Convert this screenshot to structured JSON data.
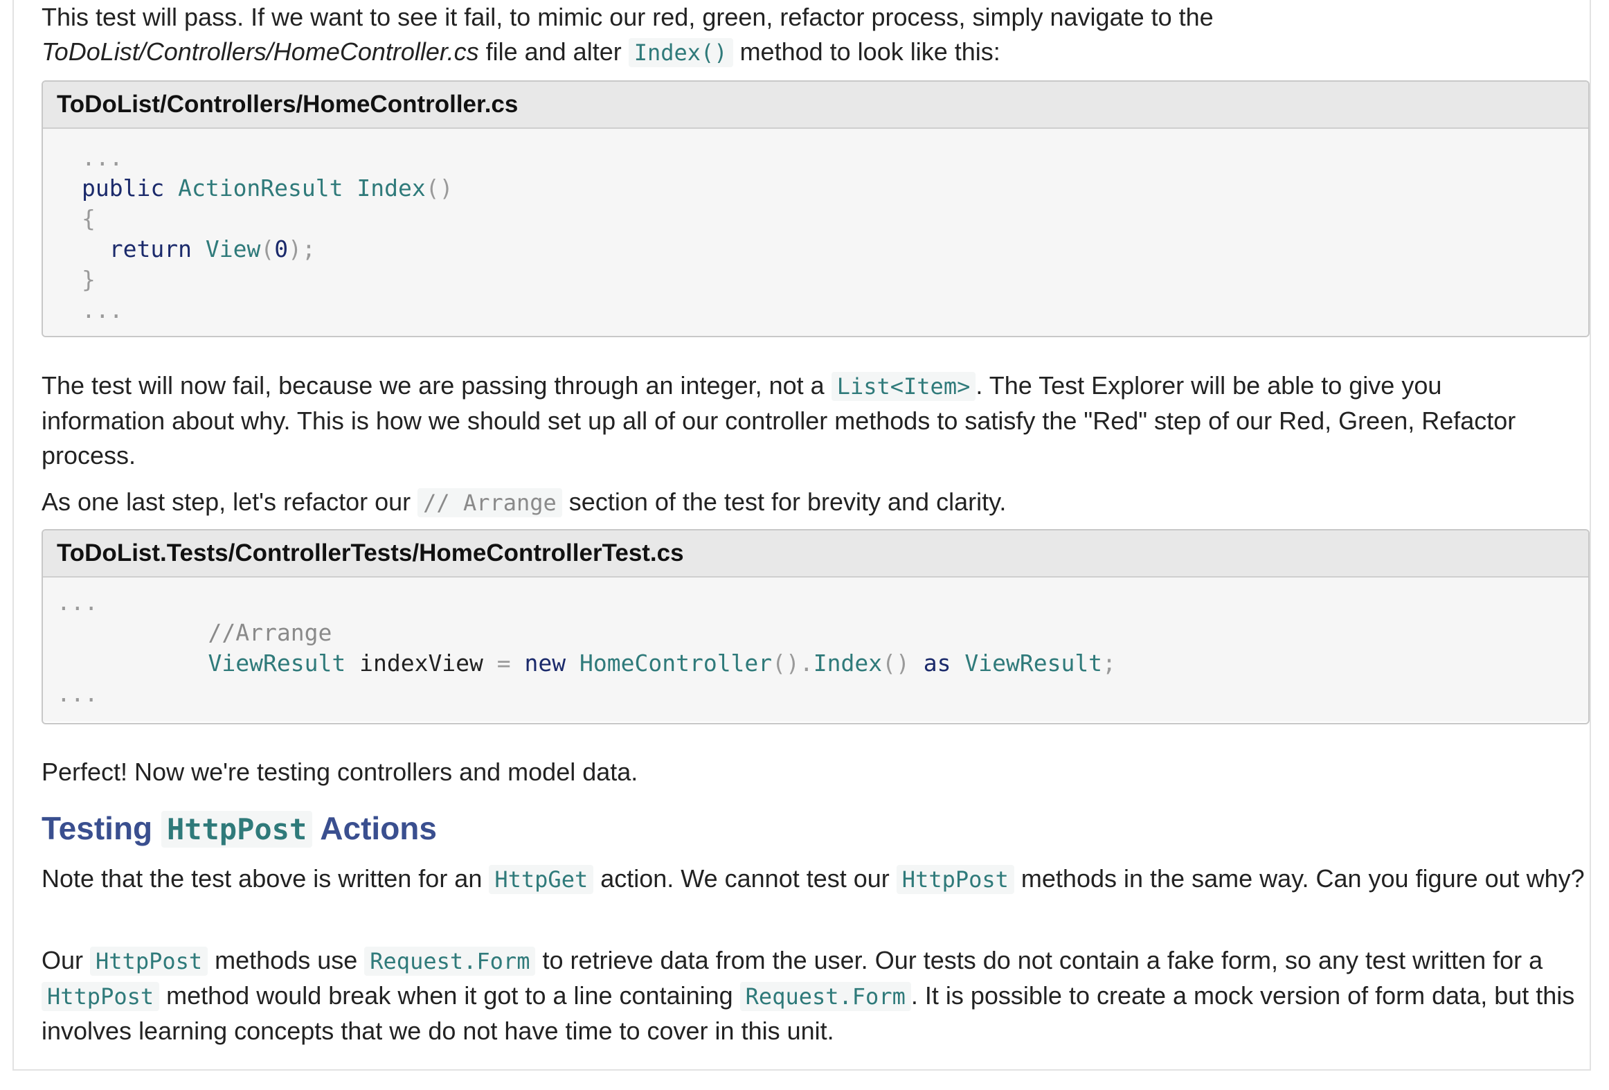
{
  "para1": {
    "t1": "This test will pass. If we want to see it fail, to mimic our red, green, refactor process, simply navigate to the",
    "path": "ToDoList/Controllers/HomeController.cs",
    "t2": " file and alter ",
    "code": "Index()",
    "t3": " method to look like this:"
  },
  "block1": {
    "title": "ToDoList/Controllers/HomeController.cs",
    "ellipsis": "...",
    "kw_public": "public",
    "type_actionresult": "ActionResult",
    "fn_index": "Index",
    "parens": "()",
    "brace_open": "{",
    "kw_return": "return",
    "fn_view": "View",
    "paren_open": "(",
    "arg_zero": "0",
    "paren_close_semi": ");",
    "brace_close": "}"
  },
  "para2": {
    "t1": "The test will now fail, because we are passing through an integer, not a ",
    "code": "List<Item>",
    "t2": ". The Test Explorer will be able to give you information about why. This is how we should set up all of our controller methods to satisfy the \"Red\" step of our Red, Green, Refactor process."
  },
  "para3": {
    "t1": "As one last step, let's refactor our ",
    "code": "// Arrange",
    "t2": " section of the test for brevity and clarity."
  },
  "block2": {
    "title": "ToDoList.Tests/ControllerTests/HomeControllerTest.cs",
    "ellipsis": "...",
    "comment": "//Arrange",
    "type_viewresult": "ViewResult",
    "var_name": " indexView ",
    "eq": "=",
    "kw_new": "new",
    "type_homecontroller": "HomeController",
    "call_parens": "().",
    "fn_index": "Index",
    "parens": "()",
    "kw_as": "as",
    "type_viewresult2": "ViewResult",
    "semi": ";"
  },
  "para4": {
    "text": "Perfect! Now we're testing controllers and model data."
  },
  "heading": {
    "t1": "Testing ",
    "code": "HttpPost",
    "t2": " Actions"
  },
  "para5": {
    "t1": "Note that the test above is written for an ",
    "code1": "HttpGet",
    "t2": " action. We cannot test our ",
    "code2": "HttpPost",
    "t3": " methods in the same way. Can you figure out why?"
  },
  "para6": {
    "t1": "Our ",
    "code1": "HttpPost",
    "t2": " methods use ",
    "code2": "Request.Form",
    "t3": " to retrieve data from the user. Our tests do not contain a fake form, so any test written for a ",
    "code3": "HttpPost",
    "t4": " method would break when it got to a line containing ",
    "code4": "Request.Form",
    "t5": ". It is possible to create a mock version of form data, but this involves learning concepts that we do not have time to cover in this unit."
  }
}
